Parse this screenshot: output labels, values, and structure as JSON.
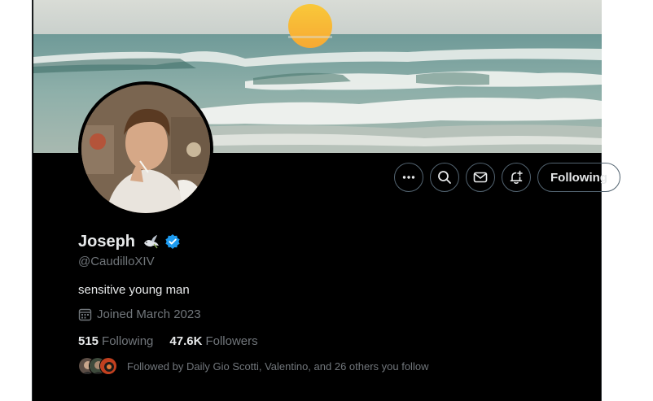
{
  "profile": {
    "display_name": "Joseph",
    "handle": "@CaudilloXIV",
    "bio": "sensitive young man",
    "joined": "Joined March 2023"
  },
  "icons": {
    "badge_emoji": "dove-emoji-icon",
    "verified": "verified-badge-icon",
    "calendar": "calendar-icon"
  },
  "actions": {
    "more": "more-icon",
    "search": "search-icon",
    "message": "mail-icon",
    "notify": "bell-plus-icon",
    "following_label": "Following"
  },
  "stats": {
    "following_count": "515",
    "following_label": "Following",
    "followers_count": "47.6K",
    "followers_label": "Followers"
  },
  "followed_by": {
    "text": "Followed by Daily Gio Scotti, Valentino, and 26 others you follow"
  },
  "colors": {
    "background": "#000000",
    "primary_text": "#e7e9ea",
    "secondary_text": "#71767b",
    "border": "#536471",
    "verified": "#1d9bf0"
  }
}
